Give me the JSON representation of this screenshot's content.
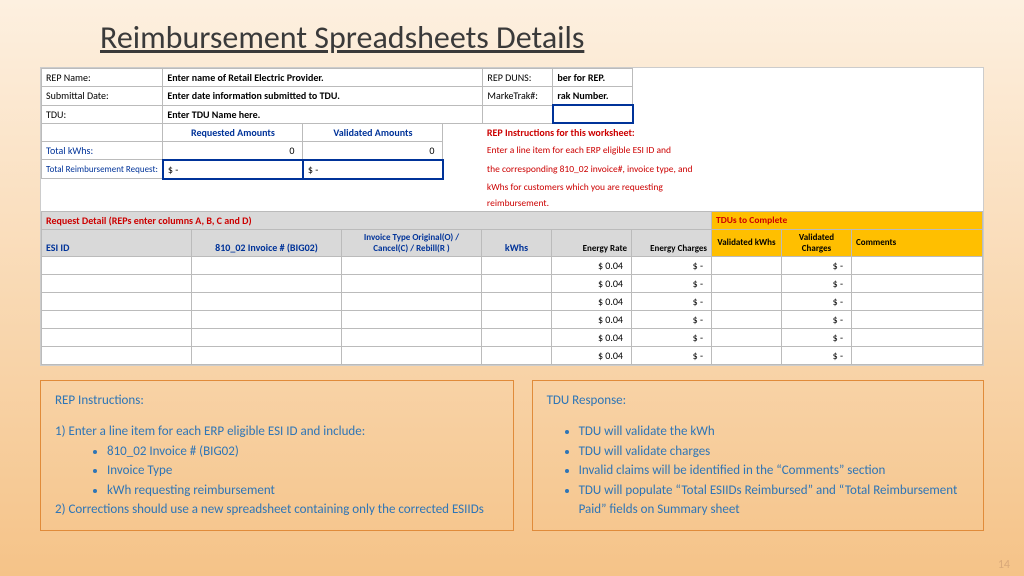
{
  "title": "Reimbursement Spreadsheets Details",
  "top": {
    "repNameLbl": "REP Name:",
    "repNameVal": "Enter name of Retail Electric Provider.",
    "repDunsLbl": "REP DUNS:",
    "repDunsVal": "ber for REP.",
    "submittalLbl": "Submittal Date:",
    "submittalVal": "Enter date information submitted to TDU.",
    "marketrakLbl": "MarkeTrak#:",
    "marketrakVal": "rak Number.",
    "tduLbl": "TDU:",
    "tduVal": "Enter TDU Name here."
  },
  "amounts": {
    "reqHdr": "Requested Amounts",
    "valHdr": "Validated Amounts",
    "totalKwhLbl": "Total kWhs:",
    "totalKwhReq": "0",
    "totalKwhVal": "0",
    "totalReimbLbl": "Total Reimbursement Request:",
    "totalReimbReq": "$                    -",
    "totalReimbVal": "$                    -"
  },
  "instr": {
    "hdr": "REP Instructions for this worksheet:",
    "l1": "Enter a line item for each ERP eligible ESI ID and",
    "l2": "the corresponding 810_02 invoice#, invoice type, and",
    "l3": "kWhs for customers which you are requesting",
    "l4": "reimbursement."
  },
  "detailTitle": "Request Detail (REPs enter columns A, B, C and D)",
  "tduTitle": "TDUs to Complete",
  "cols": {
    "esi": "ESI ID",
    "inv": "810_02 Invoice #  (BIG02)",
    "invType": "Invoice Type Original(O) / Cancel(C) / Rebill(R )",
    "kwh": "kWhs",
    "rate": "Energy Rate",
    "charges": "Energy Charges",
    "vkwh": "Validated kWhs",
    "vcharges": "Validated Charges",
    "comments": "Comments"
  },
  "dataRows": [
    {
      "rate": "$          0.04",
      "charges": "$           -",
      "vcharges": "$           -"
    },
    {
      "rate": "$          0.04",
      "charges": "$           -",
      "vcharges": "$           -"
    },
    {
      "rate": "$          0.04",
      "charges": "$           -",
      "vcharges": "$           -"
    },
    {
      "rate": "$          0.04",
      "charges": "$           -",
      "vcharges": "$           -"
    },
    {
      "rate": "$          0.04",
      "charges": "$           -",
      "vcharges": "$           -"
    },
    {
      "rate": "$          0.04",
      "charges": "$           -",
      "vcharges": "$           -"
    }
  ],
  "leftBox": {
    "hdr": "REP Instructions:",
    "p1": "1) Enter a line item for each ERP eligible ESI ID and include:",
    "b1": "810_02 Invoice # (BIG02)",
    "b2": "Invoice Type",
    "b3": "kWh requesting reimbursement",
    "p2": "2) Corrections should use a new spreadsheet containing only the corrected ESIIDs"
  },
  "rightBox": {
    "hdr": "TDU Response:",
    "b1": "TDU will validate the kWh",
    "b2": "TDU will validate charges",
    "b3": "Invalid claims will be identified in the “Comments” section",
    "b4": "TDU will populate “Total ESIIDs Reimbursed” and “Total Reimbursement Paid” fields on Summary sheet"
  },
  "pageNum": "14"
}
